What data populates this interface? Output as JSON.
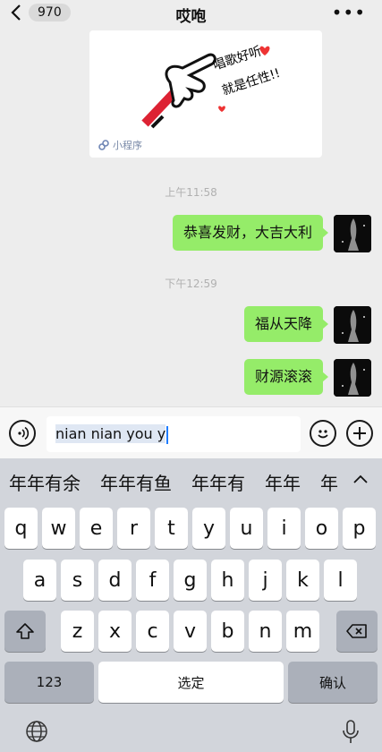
{
  "header": {
    "back_count": "970",
    "title": "哎咆",
    "more_label": "•••"
  },
  "mini_program": {
    "label": "小程序",
    "art_text_line1": "唱歌好听，",
    "art_text_line2": "就是任性!!"
  },
  "messages": [
    {
      "time": "上午11:58",
      "text": "恭喜发财，大吉大利"
    },
    {
      "time": "下午12:59",
      "text": "福从天降"
    },
    {
      "time": "",
      "text": "财源滚滚"
    }
  ],
  "input": {
    "composing_text": "nian nian you y"
  },
  "candidates": [
    "年年有余",
    "年年有鱼",
    "年年有",
    "年年",
    "年"
  ],
  "keyboard": {
    "row1": [
      "q",
      "w",
      "e",
      "r",
      "t",
      "y",
      "u",
      "i",
      "o",
      "p"
    ],
    "row2": [
      "a",
      "s",
      "d",
      "f",
      "g",
      "h",
      "j",
      "k",
      "l"
    ],
    "row3": [
      "z",
      "x",
      "c",
      "v",
      "b",
      "n",
      "m"
    ],
    "numbers_label": "123",
    "space_label": "选定",
    "confirm_label": "确认"
  },
  "icons": {
    "back": "chevron-left-icon",
    "voice": "voice-icon",
    "emoji": "emoji-icon",
    "plus": "plus-icon",
    "shift": "shift-icon",
    "delete": "backspace-icon",
    "globe": "globe-icon",
    "mic": "microphone-icon"
  }
}
